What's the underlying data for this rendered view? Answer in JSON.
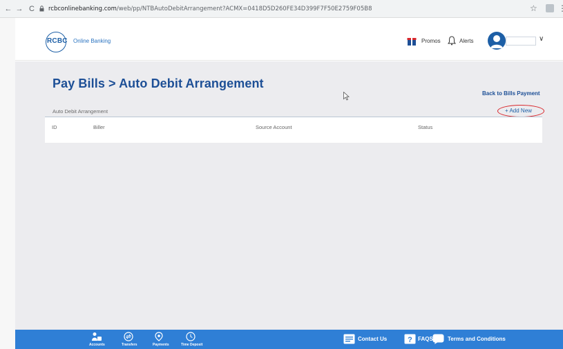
{
  "browser": {
    "back_glyph": "←",
    "forward_glyph": "→",
    "reload_glyph": "C",
    "url_host": "rcbconlinebanking.com",
    "url_path": "/web/pp/NTBAutoDebitArrangement?ACMX=0418D5D260FE34D399F7F50E2759F05B8",
    "star_glyph": "☆",
    "menu_glyph": "⋮"
  },
  "header": {
    "logo_text": "RCBC",
    "logo_sub": "Online Banking",
    "promos_label": "Promos",
    "alerts_label": "Alerts",
    "chevron_glyph": "∨"
  },
  "main": {
    "title": "Pay Bills > Auto Debit Arrangement",
    "back_link": "Back to Bills Payment",
    "section_label": "Auto Debit Arrangement",
    "add_new": "+ Add New",
    "columns": [
      "ID",
      "Biller",
      "Source Account",
      "Status"
    ]
  },
  "bottom_nav": {
    "items": [
      "Accounts",
      "Transfers",
      "Payments",
      "Time Deposit"
    ],
    "contact": "Contact Us",
    "faqs": "FAQS",
    "terms": "Terms and Conditions"
  },
  "colors": {
    "brand_blue": "#1d4f96",
    "bar_blue": "#2f7fd6",
    "annotation_red": "#d9262b"
  }
}
